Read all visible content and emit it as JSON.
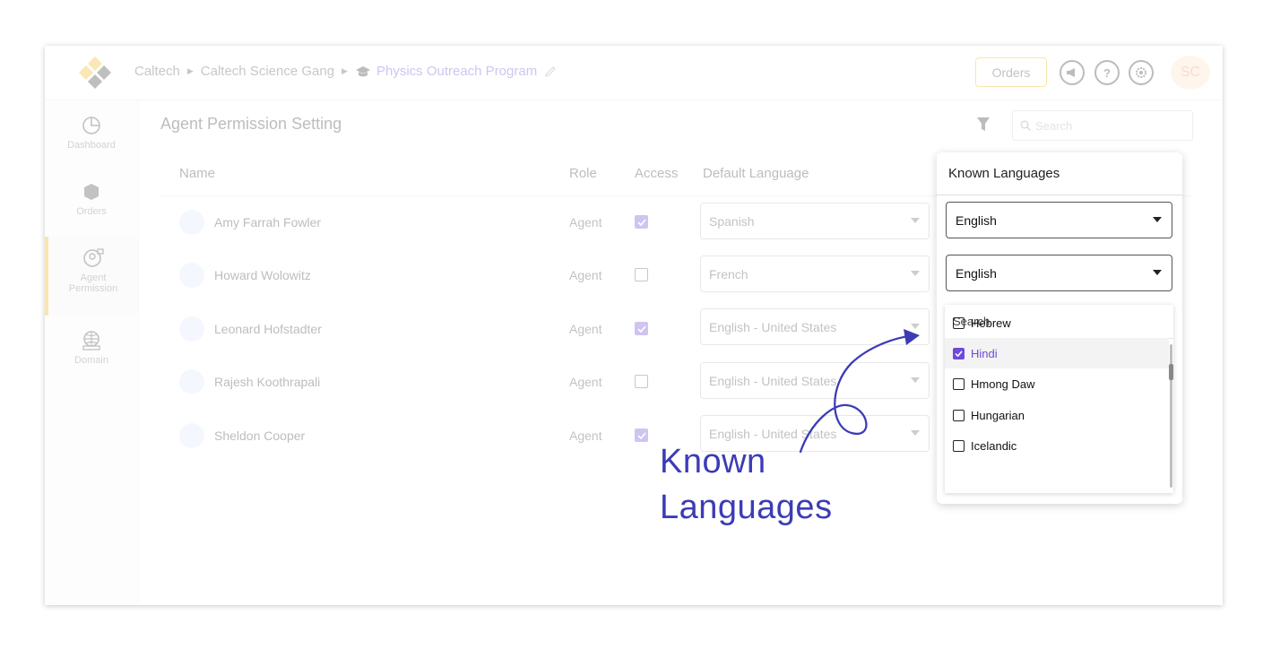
{
  "breadcrumb": {
    "items": [
      "Caltech",
      "Caltech Science Gang"
    ],
    "current": "Physics Outreach Program"
  },
  "topbar": {
    "orders_label": "Orders",
    "avatar_initials": "SC",
    "icons": [
      "megaphone-icon",
      "help-icon",
      "settings-icon"
    ]
  },
  "sidebar": {
    "items": [
      {
        "label": "Dashboard",
        "icon": "dashboard-icon"
      },
      {
        "label": "Orders",
        "icon": "box-icon"
      },
      {
        "label": "Agent Permission",
        "icon": "agent-permission-icon",
        "active": true
      },
      {
        "label": "Domain",
        "icon": "globe-icon"
      }
    ]
  },
  "page": {
    "title": "Agent Permission Setting",
    "search_placeholder": "Search"
  },
  "table": {
    "columns": [
      "Name",
      "Role",
      "Access",
      "Default Language"
    ],
    "rows": [
      {
        "name": "Amy Farrah Fowler",
        "role": "Agent",
        "access": true,
        "language": "Spanish"
      },
      {
        "name": "Howard Wolowitz",
        "role": "Agent",
        "access": false,
        "language": "French"
      },
      {
        "name": "Leonard Hofstadter",
        "role": "Agent",
        "access": true,
        "language": "English - United States"
      },
      {
        "name": "Rajesh Koothrapali",
        "role": "Agent",
        "access": false,
        "language": "English - United States"
      },
      {
        "name": "Sheldon Cooper",
        "role": "Agent",
        "access": true,
        "language": "English - United States"
      }
    ]
  },
  "popup": {
    "title": "Known Languages",
    "select_1": "English",
    "select_2": "English",
    "search_placeholder": "Search",
    "options": [
      {
        "label": "Hebrew",
        "checked": false
      },
      {
        "label": "Hindi",
        "checked": true
      },
      {
        "label": "Hmong Daw",
        "checked": false
      },
      {
        "label": "Hungarian",
        "checked": false
      },
      {
        "label": "Icelandic",
        "checked": false
      }
    ]
  },
  "annotation": {
    "line1": "Known",
    "line2": "Languages"
  },
  "colors": {
    "accent": "#6d4bd8",
    "orders_border": "#f0b400",
    "annotation": "#3c3cb5"
  }
}
